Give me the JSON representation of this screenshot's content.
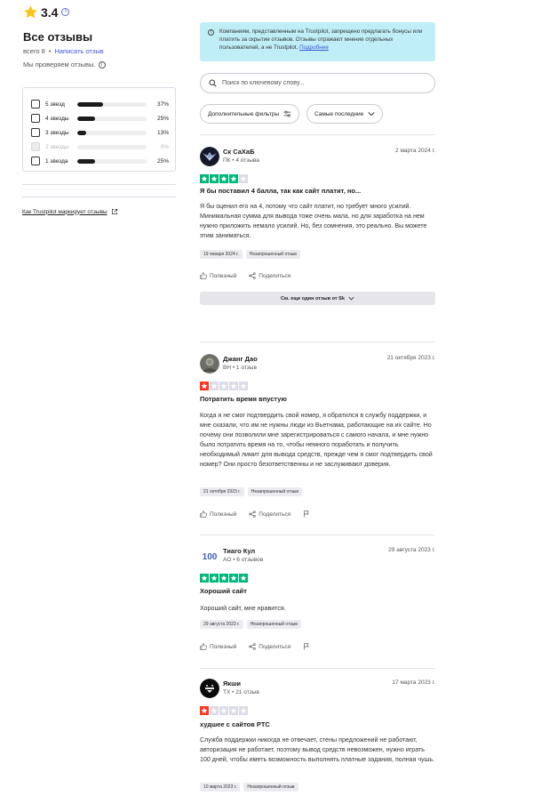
{
  "colors": {
    "star_green": "#00b67a",
    "star_red": "#ff3722",
    "star_empty": "#dcdce6",
    "notice_bg": "#bfeef7",
    "link": "#3b57d8"
  },
  "summary": {
    "score": "3.4",
    "all_reviews_title": "Все отзывы",
    "total_label": "всего 8",
    "write_review": "Написать отзыв",
    "verify_text": "Мы проверяем отзывы.",
    "how_marks": "Как Trustpilot маркирует отзывы"
  },
  "filters": [
    {
      "label": "5 звезд",
      "percent": "37%",
      "fraction": 0.37,
      "disabled": false
    },
    {
      "label": "4 звезды",
      "percent": "25%",
      "fraction": 0.25,
      "disabled": false
    },
    {
      "label": "3 звезды",
      "percent": "13%",
      "fraction": 0.13,
      "disabled": false
    },
    {
      "label": "2 звезды",
      "percent": "0%",
      "fraction": 0.0,
      "disabled": true
    },
    {
      "label": "1 звезда",
      "percent": "25%",
      "fraction": 0.25,
      "disabled": false
    }
  ],
  "notice": {
    "text": "Компаниям, представленным на Trustpilot, запрещено предлагать бонусы или платить за скрытие отзывов. Отзывы отражают мнение отдельных пользователей, а не Trustpilot.",
    "more": "Подробнее"
  },
  "search": {
    "placeholder": "Поиск по ключевому слову..."
  },
  "controls": {
    "more_filters": "Дополнительные фильтры",
    "sort": "Самые последние"
  },
  "reviews": [
    {
      "name": "Ск СаХаБ",
      "meta": "ПК • 4 отзыва",
      "date": "2 марта 2024 г.",
      "rating": 4,
      "title": "Я бы поставил 4 балла, так как сайт платит, но...",
      "body": "Я бы оценил его на 4, потому что сайт платит, но требует много усилий. Минимальная сумма для вывода тоже очень мала, но для заработка на нем нужно приложить немало усилий. Но, без сомнения, это реально. Вы можете этим заниматься.",
      "date_tag": "19 января 2024 г.",
      "unprompted": "Незапрошенный отзыв",
      "see_more": "См. еще один отзыв от Sk"
    },
    {
      "name": "Джанг Дао",
      "meta": "ВН • 1 отзыв",
      "date": "21 октября 2023 г.",
      "rating": 1,
      "title": "Потратить время впустую",
      "body": "Когда я не смог подтвердить свой номер, я обратился в службу поддержки, и мне сказали, что им не нужны люди из Вьетнама, работающие на их сайте. Но почему они позволили мне зарегистрироваться с самого начала, и мне нужно было потратить время на то, чтобы немного поработать и получить необходимый лимит для вывода средств, прежде чем я смог подтвердить свой номер? Они просто безответственны и не заслуживают доверия.",
      "date_tag": "21 октября 2023 г.",
      "unprompted": "Незапрошенный отзыв"
    },
    {
      "name": "Тиаго Кул",
      "meta": "AO • 6 отзывов",
      "avatar_text": "100",
      "date": "29 августа 2023 г.",
      "rating": 5,
      "title": "Хороший сайт",
      "body": "Хороший сайт, мне нравится.",
      "date_tag": "29 августа 2023 г.",
      "unprompted": "Незапрошенный отзыв"
    },
    {
      "name": "Якши",
      "meta": "TX • 21 отзыв",
      "date": "17 марта 2023 г.",
      "rating": 1,
      "title": "худшее с сайтов PTC",
      "body": "Служба поддержки никогда не отвечает, стены предложений не работают, авторизация не работает, поэтому вывод средств невозможен, нужно играть 100 дней, чтобы иметь возможность выполнять платные задания, полная чушь.",
      "date_tag": "10 марта 2023 г.",
      "unprompted": "Незапрошенный отзыв"
    }
  ],
  "actions": {
    "useful": "Полезный",
    "share": "Поделиться"
  }
}
